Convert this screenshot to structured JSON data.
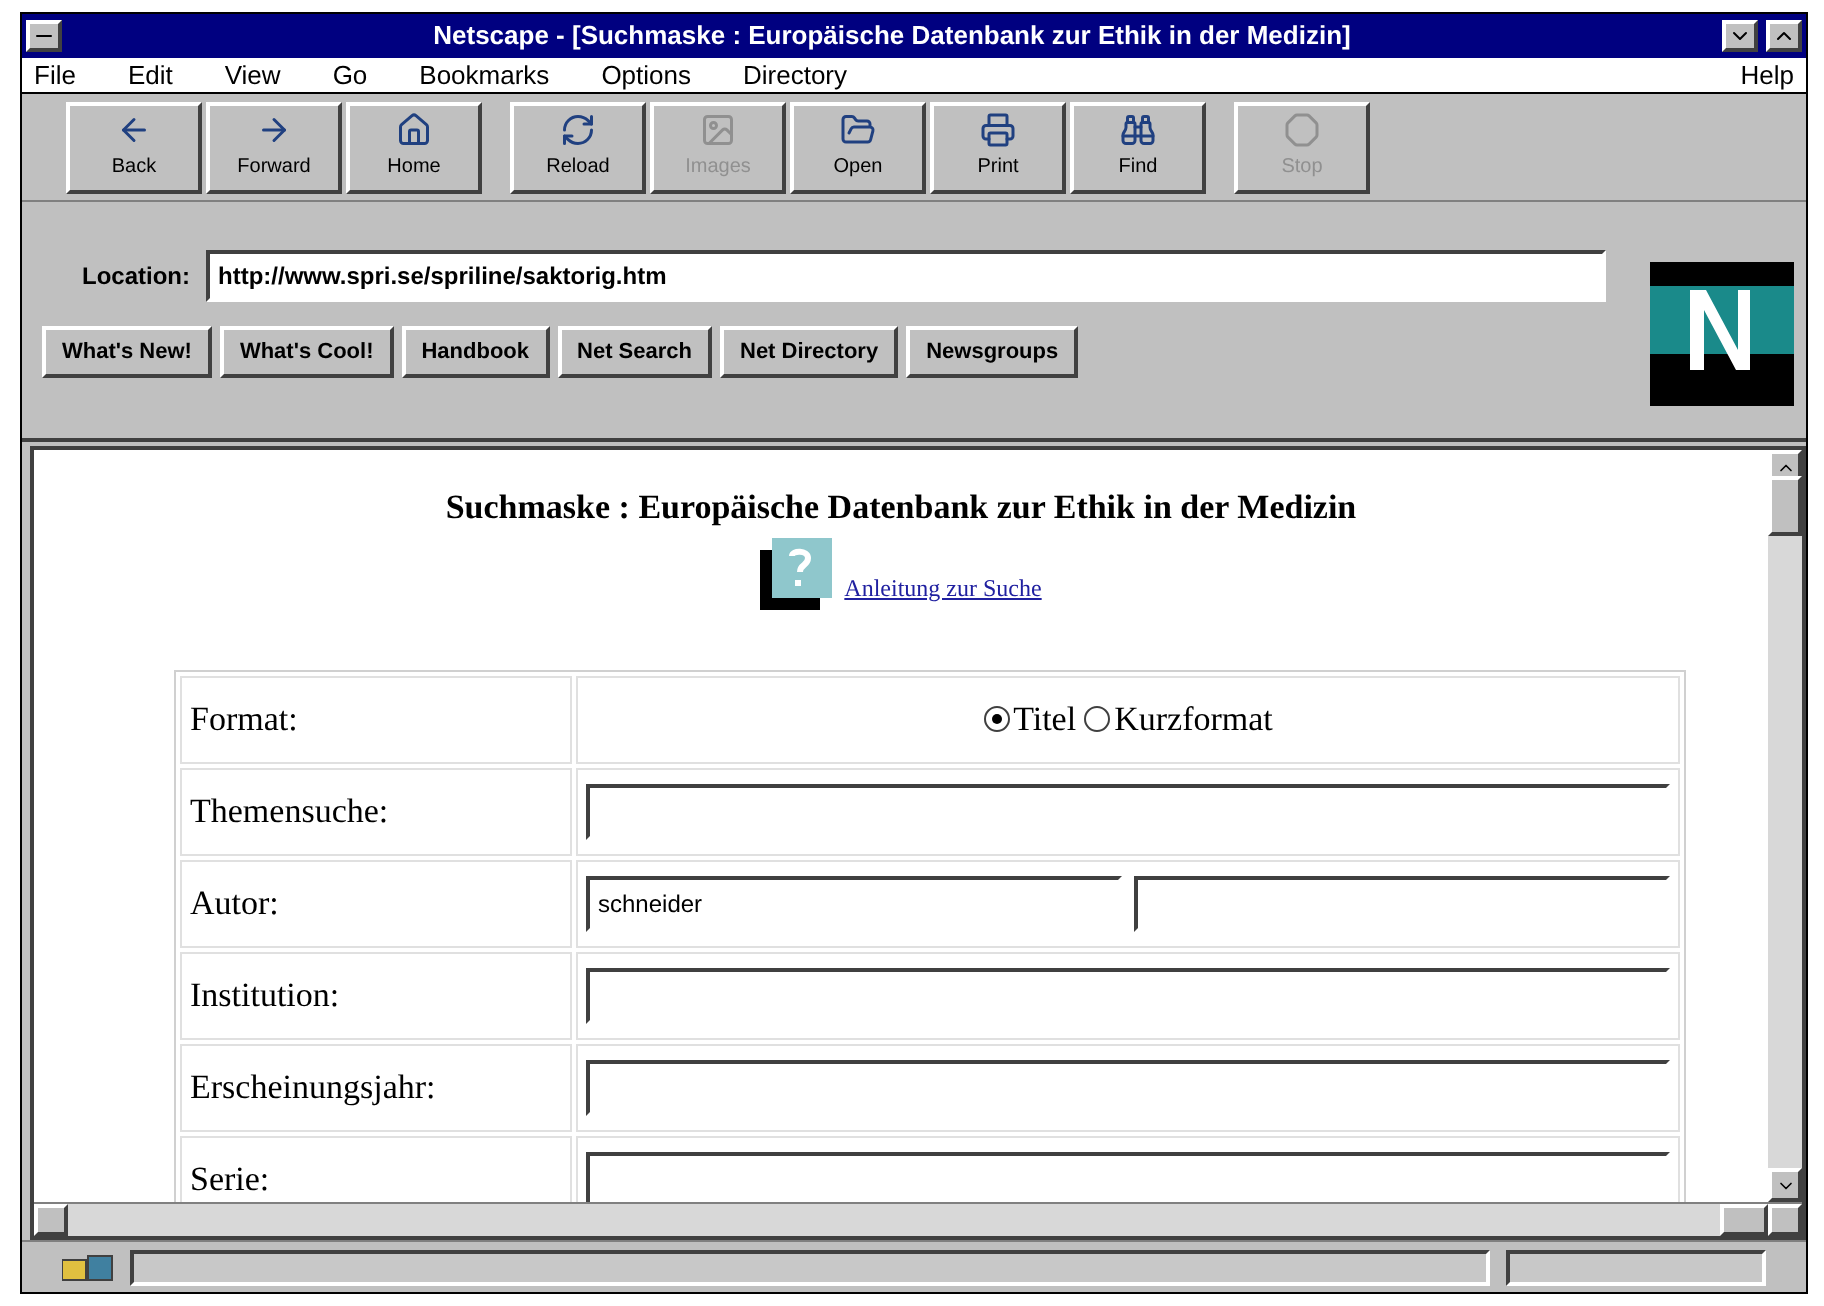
{
  "window": {
    "title": "Netscape - [Suchmaske : Europäische Datenbank zur Ethik in der Medizin]"
  },
  "menu": [
    {
      "label": "File"
    },
    {
      "label": "Edit"
    },
    {
      "label": "View"
    },
    {
      "label": "Go"
    },
    {
      "label": "Bookmarks"
    },
    {
      "label": "Options"
    },
    {
      "label": "Directory"
    }
  ],
  "menu_right": {
    "label": "Help"
  },
  "toolbar": [
    {
      "label": "Back",
      "disabled": false
    },
    {
      "label": "Forward",
      "disabled": false
    },
    {
      "label": "Home",
      "disabled": false
    },
    {
      "label": "Reload",
      "disabled": false
    },
    {
      "label": "Images",
      "disabled": true
    },
    {
      "label": "Open",
      "disabled": false
    },
    {
      "label": "Print",
      "disabled": false
    },
    {
      "label": "Find",
      "disabled": false
    },
    {
      "label": "Stop",
      "disabled": true
    }
  ],
  "location": {
    "label": "Location:",
    "value": "http://www.spri.se/spriline/saktorig.htm"
  },
  "directory_buttons": [
    "What's New!",
    "What's Cool!",
    "Handbook",
    "Net Search",
    "Net Directory",
    "Newsgroups"
  ],
  "page": {
    "heading": "Suchmaske : Europäische Datenbank zur Ethik in der Medizin",
    "help_link": "Anleitung zur Suche",
    "rows": [
      {
        "kind": "radio",
        "label": "Format:",
        "options": [
          {
            "label": "Titel",
            "selected": true
          },
          {
            "label": "Kurzformat",
            "selected": false
          }
        ]
      },
      {
        "kind": "field",
        "label": "Themensuche:"
      },
      {
        "kind": "pair",
        "label": "Autor:",
        "value": "schneider"
      },
      {
        "kind": "field",
        "label": "Institution:"
      },
      {
        "kind": "field",
        "label": "Erscheinungsjahr:"
      },
      {
        "kind": "field",
        "label": "Serie:"
      }
    ]
  }
}
